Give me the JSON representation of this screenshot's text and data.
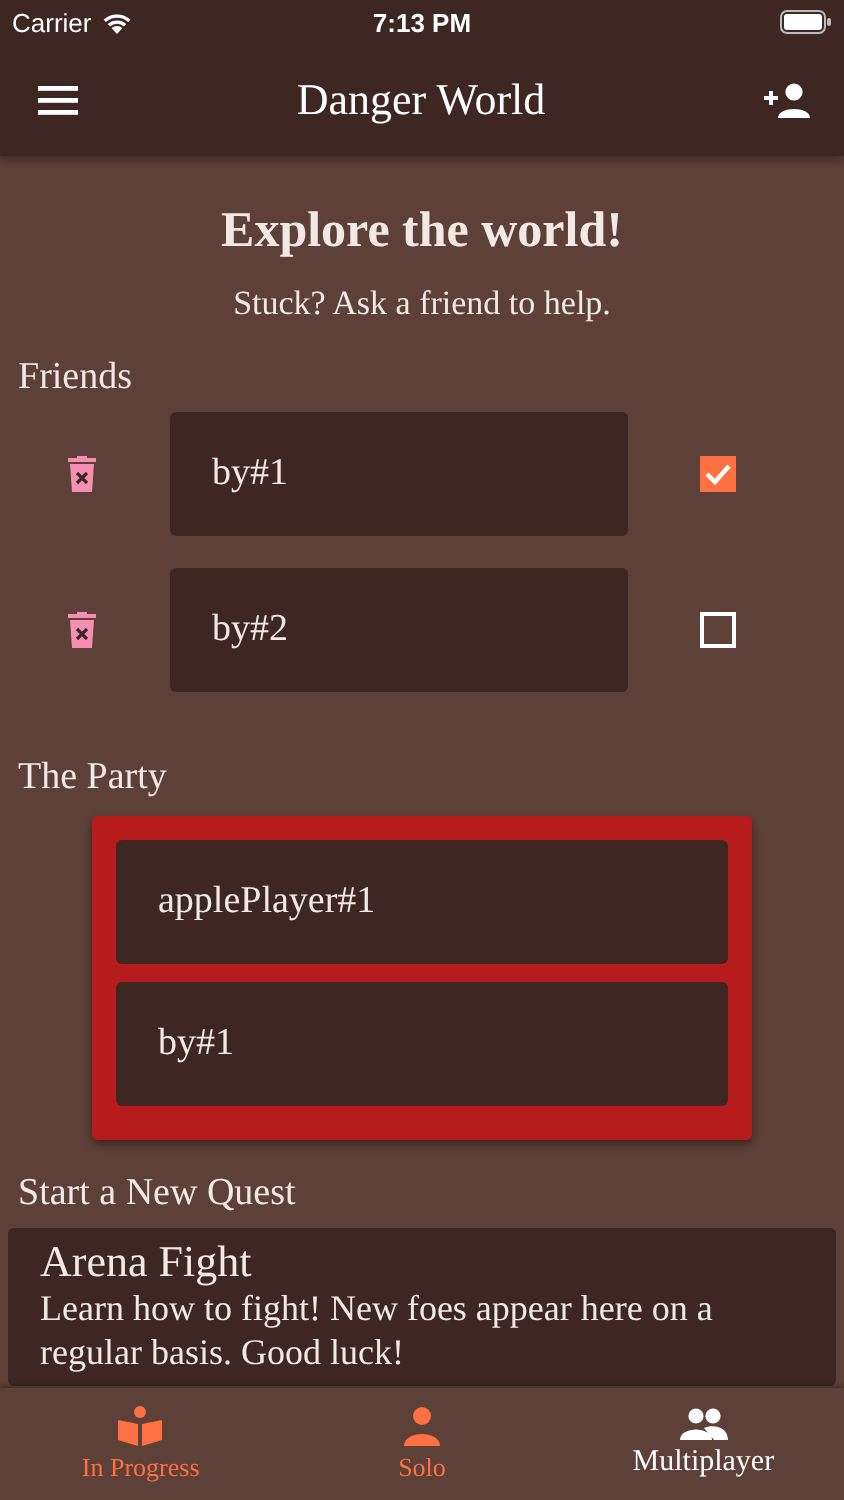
{
  "status_bar": {
    "carrier": "Carrier",
    "time": "7:13 PM"
  },
  "app_bar": {
    "title": "Danger World"
  },
  "heading": "Explore the world!",
  "subtitle": "Stuck? Ask a friend to help.",
  "friends": {
    "label": "Friends",
    "items": [
      {
        "name": "by#1",
        "checked": true
      },
      {
        "name": "by#2",
        "checked": false
      }
    ]
  },
  "party": {
    "label": "The Party",
    "members": [
      "applePlayer#1",
      "by#1"
    ]
  },
  "quests": {
    "label": "Start a New Quest",
    "items": [
      {
        "title": "Arena Fight",
        "description": "Learn how to fight! New foes appear here on a regular basis. Good luck!"
      }
    ]
  },
  "tabs": [
    {
      "label": "In Progress",
      "selected": false
    },
    {
      "label": "Solo",
      "selected": false
    },
    {
      "label": "Multiplayer",
      "selected": true
    }
  ]
}
